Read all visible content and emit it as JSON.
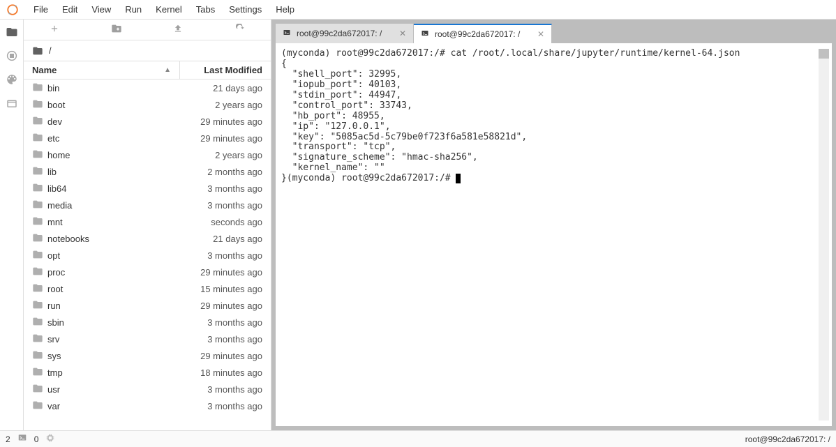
{
  "menu": [
    "File",
    "Edit",
    "View",
    "Run",
    "Kernel",
    "Tabs",
    "Settings",
    "Help"
  ],
  "breadcrumb": "/",
  "fb_header": {
    "name": "Name",
    "modified": "Last Modified"
  },
  "files": [
    {
      "name": "bin",
      "mod": "21 days ago"
    },
    {
      "name": "boot",
      "mod": "2 years ago"
    },
    {
      "name": "dev",
      "mod": "29 minutes ago"
    },
    {
      "name": "etc",
      "mod": "29 minutes ago"
    },
    {
      "name": "home",
      "mod": "2 years ago"
    },
    {
      "name": "lib",
      "mod": "2 months ago"
    },
    {
      "name": "lib64",
      "mod": "3 months ago"
    },
    {
      "name": "media",
      "mod": "3 months ago"
    },
    {
      "name": "mnt",
      "mod": "seconds ago"
    },
    {
      "name": "notebooks",
      "mod": "21 days ago"
    },
    {
      "name": "opt",
      "mod": "3 months ago"
    },
    {
      "name": "proc",
      "mod": "29 minutes ago"
    },
    {
      "name": "root",
      "mod": "15 minutes ago"
    },
    {
      "name": "run",
      "mod": "29 minutes ago"
    },
    {
      "name": "sbin",
      "mod": "3 months ago"
    },
    {
      "name": "srv",
      "mod": "3 months ago"
    },
    {
      "name": "sys",
      "mod": "29 minutes ago"
    },
    {
      "name": "tmp",
      "mod": "18 minutes ago"
    },
    {
      "name": "usr",
      "mod": "3 months ago"
    },
    {
      "name": "var",
      "mod": "3 months ago"
    }
  ],
  "tabs": [
    {
      "label": "root@99c2da672017: /",
      "active": false
    },
    {
      "label": "root@99c2da672017: /",
      "active": true
    }
  ],
  "terminal": {
    "prompt1": "(myconda) root@99c2da672017:/# cat /root/.local/share/jupyter/runtime/kernel-64.json",
    "json_lines": [
      "{",
      "  \"shell_port\": 32995,",
      "  \"iopub_port\": 40103,",
      "  \"stdin_port\": 44947,",
      "  \"control_port\": 33743,",
      "  \"hb_port\": 48955,",
      "  \"ip\": \"127.0.0.1\",",
      "  \"key\": \"5085ac5d-5c79be0f723f6a581e58821d\",",
      "  \"transport\": \"tcp\",",
      "  \"signature_scheme\": \"hmac-sha256\",",
      "  \"kernel_name\": \"\""
    ],
    "prompt2": "}(myconda) root@99c2da672017:/# "
  },
  "status": {
    "left_num1": "2",
    "left_num2": "0",
    "right": "root@99c2da672017: /"
  }
}
